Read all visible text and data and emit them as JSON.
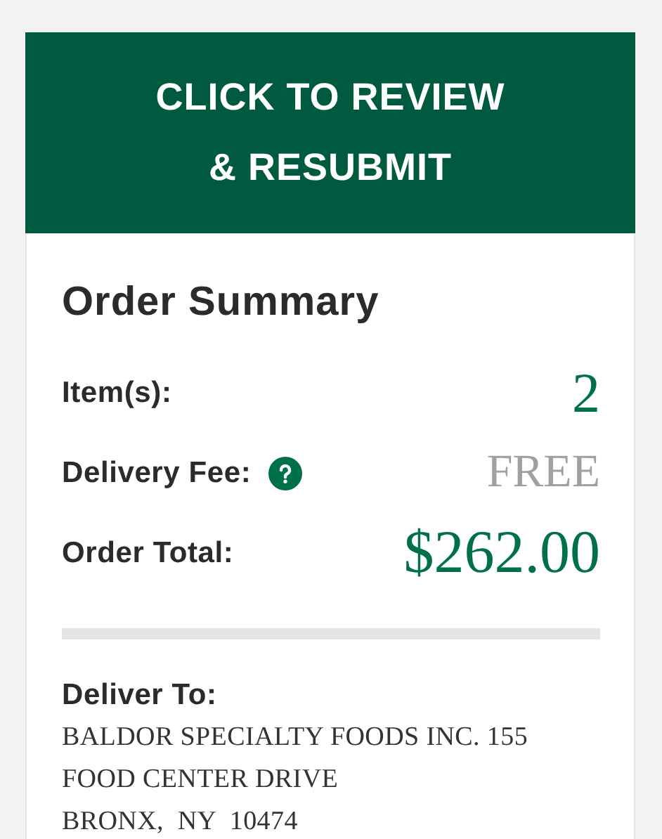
{
  "review_button": {
    "label_lines": [
      "CLICK TO REVIEW",
      "& RESUBMIT"
    ]
  },
  "summary": {
    "title": "Order Summary",
    "rows": [
      {
        "kind": "count",
        "label": "Item(s):",
        "value": "2",
        "help": false
      },
      {
        "kind": "fee",
        "label": "Delivery Fee:",
        "value": "FREE",
        "help": true
      },
      {
        "kind": "total",
        "label": "Order Total:",
        "value": "$262.00",
        "help": false
      }
    ]
  },
  "delivery": {
    "title": "Deliver To:",
    "address_lines": [
      "BALDOR SPECIALTY FOODS INC. 155",
      "FOOD CENTER DRIVE",
      "BRONX,  NY  10474"
    ]
  }
}
